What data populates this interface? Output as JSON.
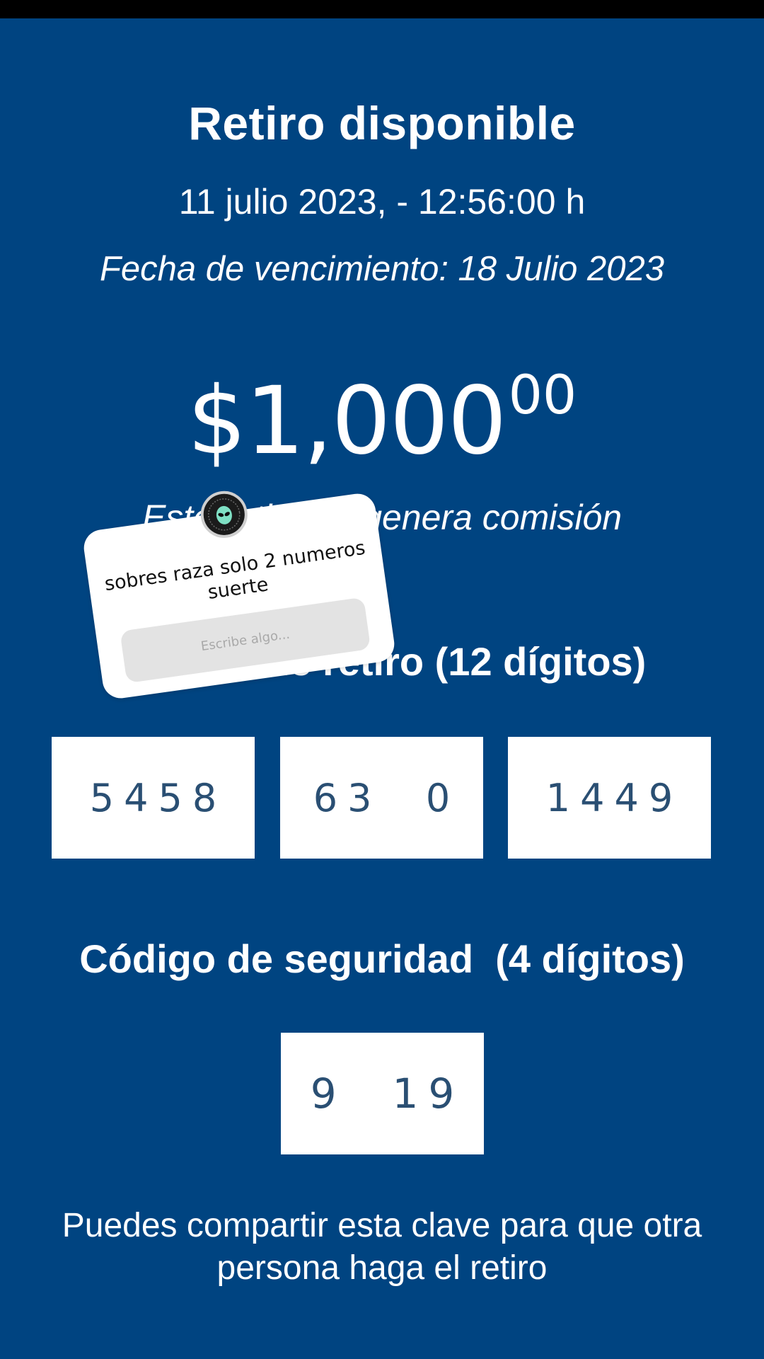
{
  "header": {
    "title": "Retiro disponible",
    "datetime": "11 julio 2023, - 12:56:00 h",
    "expiry": "Fecha de vencimiento: 18 Julio 2023"
  },
  "amount": {
    "main": "$1,000",
    "cents": "00"
  },
  "commission_text": "Este retiro no genera comisión",
  "withdraw_code": {
    "label": "Código de retiro (12 dígitos)",
    "groups": [
      "5458",
      "63  0",
      "1449"
    ]
  },
  "security_code": {
    "label": "Código de seguridad  (4 dígitos)",
    "value": "9  19"
  },
  "footer_note": "Puedes compartir esta clave para que otra persona haga el retiro",
  "sticker": {
    "question": "sobres raza solo 2 numeros suerte",
    "input_placeholder": "Escribe algo...",
    "avatar_icon": "alien-avatar-icon"
  },
  "colors": {
    "background": "#004481",
    "box": "#ffffff",
    "code_text": "#2a4f73"
  }
}
